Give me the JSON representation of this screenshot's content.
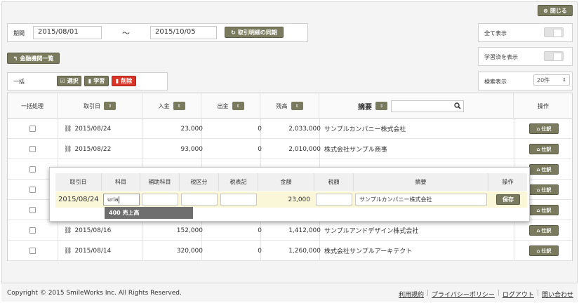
{
  "header": {
    "close_label": "閉じる"
  },
  "period": {
    "label": "期間",
    "from": "2015/08/01",
    "tilde": "〜",
    "to": "2015/10/05",
    "fetch_label": "取引明細の同期"
  },
  "filters": {
    "show_all": "全て表示",
    "show_learned": "学習済を表示",
    "per_page_label": "検索表示",
    "per_page_value": "20件"
  },
  "bank_list_label": "金融機関一覧",
  "bulk": {
    "label": "一括",
    "select": "選択",
    "learn": "学習",
    "delete": "削除"
  },
  "table": {
    "headers": {
      "bulk": "一括処理",
      "date": "取引日",
      "deposit": "入金",
      "withdraw": "出金",
      "balance": "残高",
      "summary": "摘要",
      "action": "操作"
    },
    "action_label": "仕訳",
    "rows": [
      {
        "date": "2015/08/24",
        "deposit": "23,000",
        "withdraw": "0",
        "balance": "2,033,000",
        "summary": "サンプルカンパニー株式会社"
      },
      {
        "date": "2015/08/22",
        "deposit": "93,000",
        "withdraw": "0",
        "balance": "2,010,000",
        "summary": "株式会社サンプル商事"
      },
      {
        "date": "",
        "deposit": "",
        "withdraw": "",
        "balance": "",
        "summary": ""
      },
      {
        "date": "",
        "deposit": "",
        "withdraw": "",
        "balance": "",
        "summary": ""
      },
      {
        "date": "",
        "deposit": "",
        "withdraw": "",
        "balance": "",
        "summary": ""
      },
      {
        "date": "2015/08/16",
        "deposit": "152,000",
        "withdraw": "0",
        "balance": "1,412,000",
        "summary": "サンプルアンドデザイン株式会社"
      },
      {
        "date": "2015/08/14",
        "deposit": "320,000",
        "withdraw": "0",
        "balance": "1,260,000",
        "summary": "株式会社サンプルアーキテクト"
      }
    ]
  },
  "popup": {
    "headers": [
      "取引日",
      "科目",
      "補助科目",
      "税区分",
      "税表記",
      "金額",
      "税額",
      "摘要",
      "操作"
    ],
    "date": "2015/08/24",
    "account_input": "uria",
    "amount": "23,000",
    "summary": "サンプルカンパニー株式会社",
    "save_label": "保存",
    "suggestion": "400 売上高"
  },
  "footer": {
    "copyright": "Copyright © 2015 SmileWorks Inc. All Rights Reserved.",
    "links": [
      "利用規約",
      "プライバシーポリシー",
      "ログアウト",
      "問い合わせ"
    ]
  },
  "colors": {
    "olive": "#7a7a5e",
    "danger": "#d9362a",
    "highlight_row": "#faf6d8"
  }
}
